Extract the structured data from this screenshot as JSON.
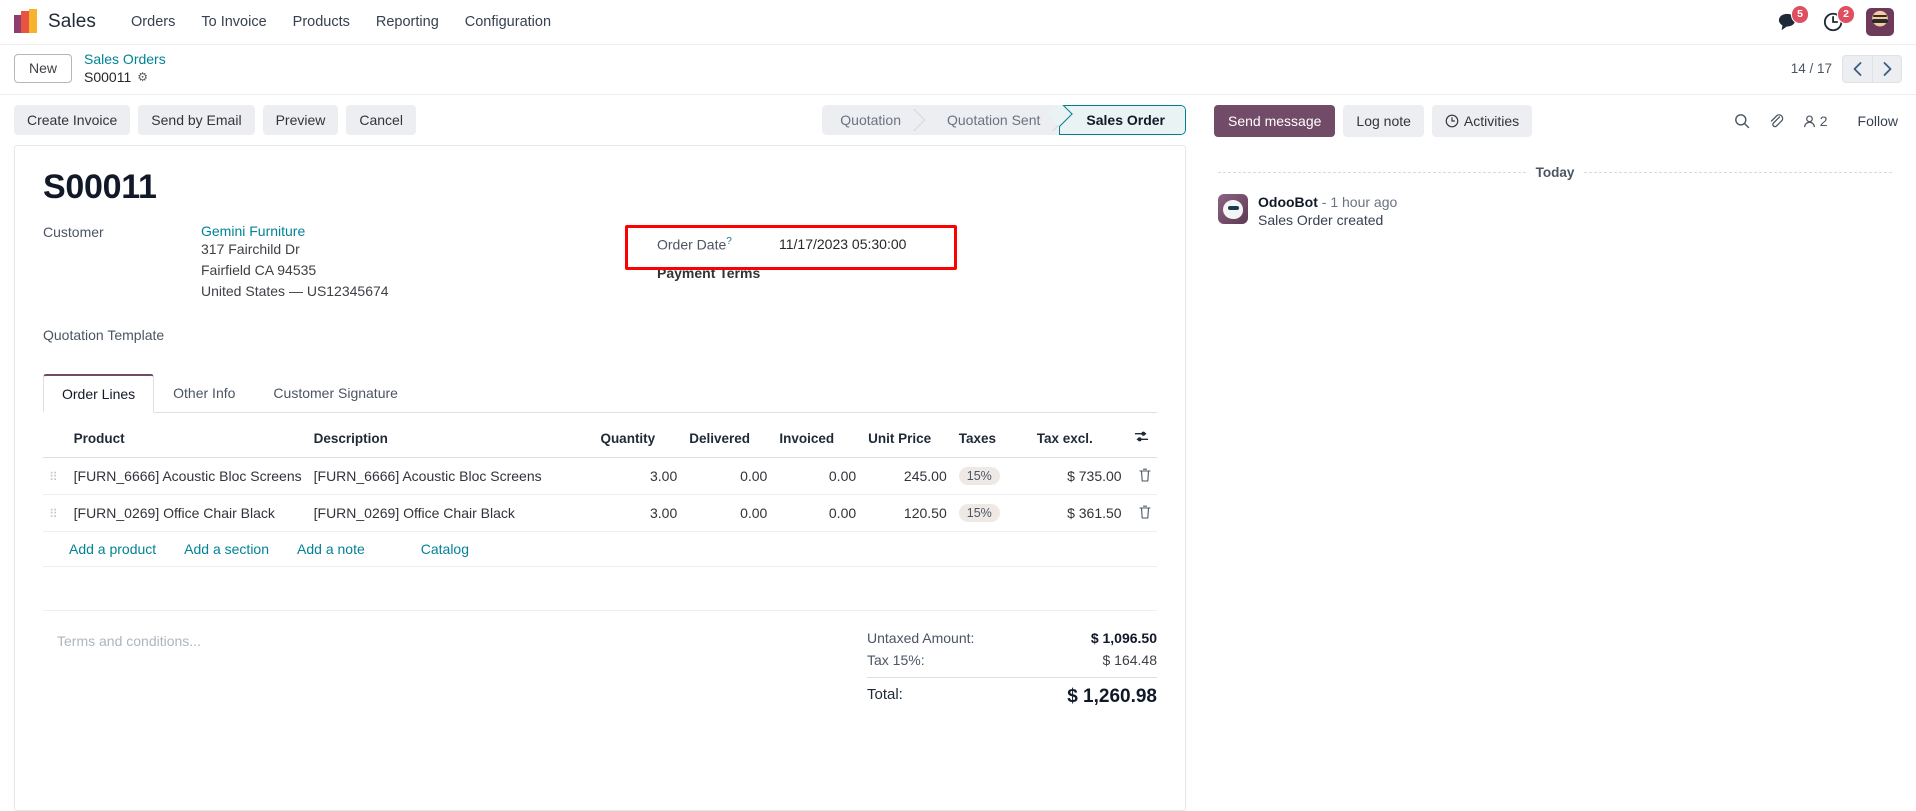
{
  "navbar": {
    "brand": "Sales",
    "logo_icon": "odoo-sales-logo",
    "menu": [
      {
        "label": "Orders"
      },
      {
        "label": "To Invoice"
      },
      {
        "label": "Products"
      },
      {
        "label": "Reporting"
      },
      {
        "label": "Configuration"
      }
    ],
    "messages_icon": "chat-bubble-icon",
    "messages_count": "5",
    "activities_icon": "clock-icon",
    "activities_count": "2",
    "avatar_icon": "user-avatar"
  },
  "control_panel": {
    "new_button": "New",
    "breadcrumb_parent": "Sales Orders",
    "breadcrumb_current": "S00011",
    "settings_icon": "gear-icon",
    "pager": "14 / 17",
    "prev_icon": "chevron-left-icon",
    "next_icon": "chevron-right-icon"
  },
  "actions": {
    "buttons": [
      {
        "label": "Create Invoice"
      },
      {
        "label": "Send by Email"
      },
      {
        "label": "Preview"
      },
      {
        "label": "Cancel"
      }
    ]
  },
  "statusbar": {
    "steps": [
      {
        "label": "Quotation",
        "active": false
      },
      {
        "label": "Quotation Sent",
        "active": false
      },
      {
        "label": "Sales Order",
        "active": true
      }
    ]
  },
  "chatter_topbar": {
    "send_message": "Send message",
    "log_note": "Log note",
    "activities": "Activities",
    "activities_icon": "clock-icon",
    "search_icon": "search-icon",
    "attachment_icon": "paperclip-icon",
    "followers_icon": "user-icon",
    "followers_count": "2",
    "follow": "Follow"
  },
  "form": {
    "title": "S00011",
    "customer_label": "Customer",
    "customer_name": "Gemini Furniture",
    "address": [
      "317 Fairchild Dr",
      "Fairfield CA 94535",
      "United States — US12345674"
    ],
    "quotation_template_label": "Quotation Template",
    "quotation_template_value": "",
    "order_date_label": "Order Date",
    "order_date_help": "?",
    "order_date_value": "11/17/2023 05:30:00",
    "payment_terms_label": "Payment Terms",
    "payment_terms_value": "",
    "highlight_color": "#ff0000"
  },
  "notebook": {
    "tabs": [
      {
        "label": "Order Lines",
        "active": true
      },
      {
        "label": "Other Info",
        "active": false
      },
      {
        "label": "Customer Signature",
        "active": false
      }
    ]
  },
  "order_lines": {
    "columns": [
      "Product",
      "Description",
      "Quantity",
      "Delivered",
      "Invoiced",
      "Unit Price",
      "Taxes",
      "Tax excl."
    ],
    "optional_columns_icon": "sliders-icon",
    "rows": [
      {
        "handle_icon": "drag-handle-icon",
        "product": "[FURN_6666] Acoustic Bloc Screens",
        "description": "[FURN_6666] Acoustic Bloc Screens",
        "quantity": "3.00",
        "delivered": "0.00",
        "invoiced": "0.00",
        "unit_price": "245.00",
        "taxes": "15%",
        "tax_excl": "$ 735.00",
        "delete_icon": "trash-icon"
      },
      {
        "handle_icon": "drag-handle-icon",
        "product": "[FURN_0269] Office Chair Black",
        "description": "[FURN_0269] Office Chair Black",
        "quantity": "3.00",
        "delivered": "0.00",
        "invoiced": "0.00",
        "unit_price": "120.50",
        "taxes": "15%",
        "tax_excl": "$ 361.50",
        "delete_icon": "trash-icon"
      }
    ],
    "add_links": [
      {
        "label": "Add a product"
      },
      {
        "label": "Add a section"
      },
      {
        "label": "Add a note"
      },
      {
        "label": "Catalog"
      }
    ]
  },
  "footer": {
    "terms_placeholder": "Terms and conditions...",
    "untaxed_label": "Untaxed Amount:",
    "untaxed_value": "$ 1,096.50",
    "tax_label": "Tax 15%:",
    "tax_value": "$ 164.48",
    "total_label": "Total:",
    "total_value": "$ 1,260.98"
  },
  "chatter": {
    "day_separator": "Today",
    "messages": [
      {
        "avatar_icon": "odoobot-avatar",
        "author": "OdooBot",
        "time": "- 1 hour ago",
        "text": "Sales Order created"
      }
    ]
  }
}
